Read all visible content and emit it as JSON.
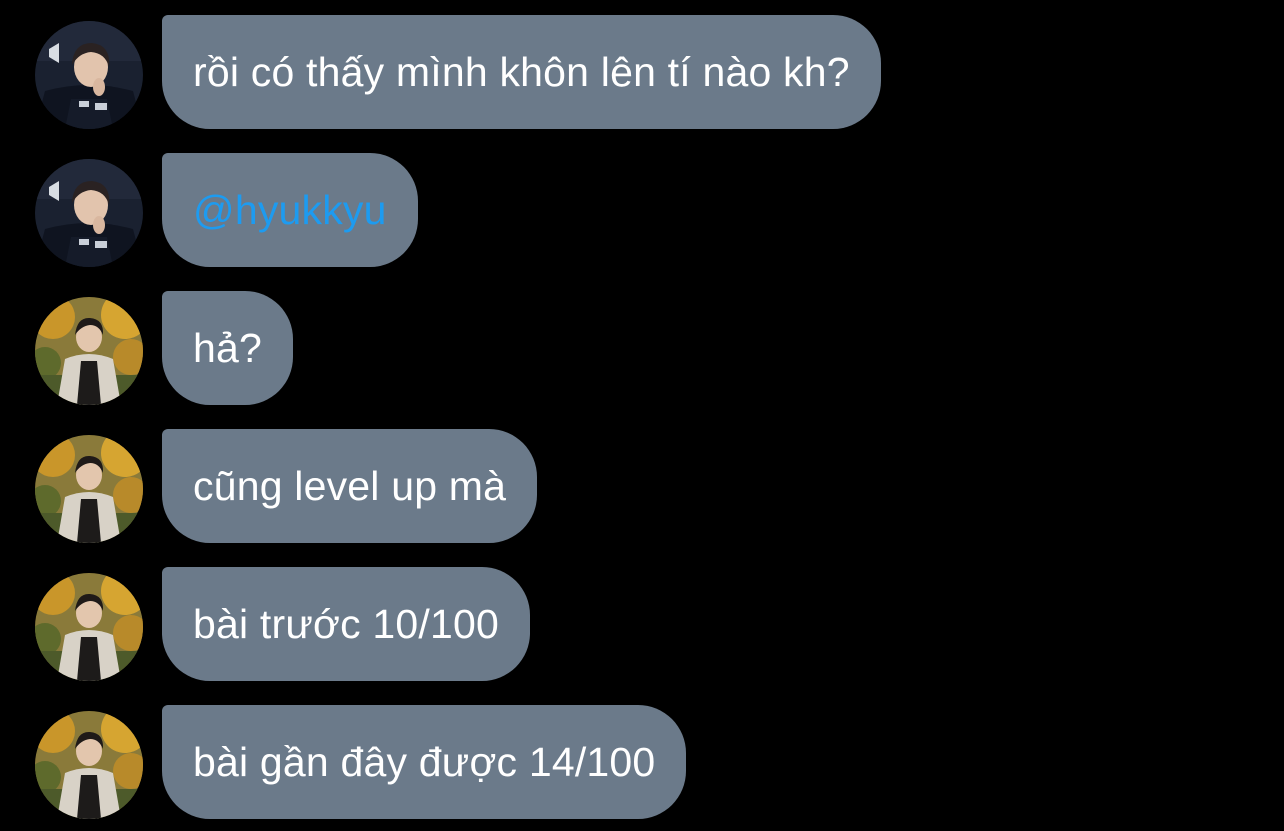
{
  "conversation": {
    "messages": [
      {
        "sender": "gamer",
        "text": "rồi có thấy mình khôn lên tí nào kh?",
        "type": "text"
      },
      {
        "sender": "gamer",
        "text": "@hyukkyu",
        "type": "mention"
      },
      {
        "sender": "autumn",
        "text": "hả?",
        "type": "text"
      },
      {
        "sender": "autumn",
        "text": "cũng level up mà",
        "type": "text"
      },
      {
        "sender": "autumn",
        "text": "bài trước 10/100",
        "type": "text"
      },
      {
        "sender": "autumn",
        "text": "bài gần đây được 14/100",
        "type": "text"
      }
    ]
  },
  "colors": {
    "background": "#000000",
    "bubble": "#6b7a8a",
    "text": "#ffffff",
    "mention": "#1d9bf0"
  }
}
